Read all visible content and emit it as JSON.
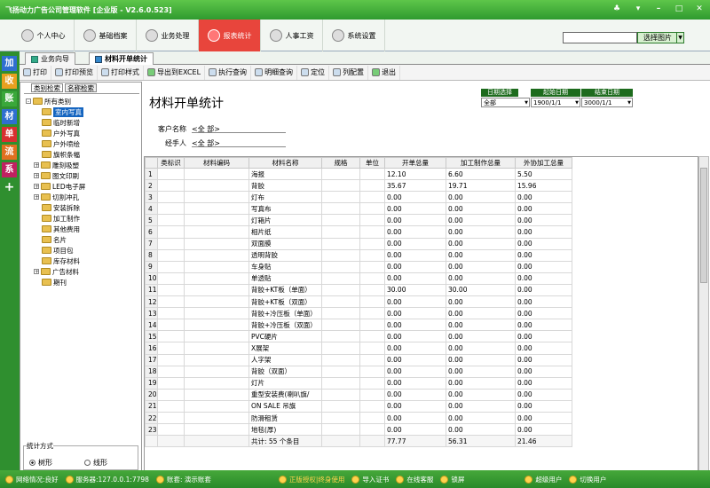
{
  "window": {
    "title": "飞扬动力广告公司管理软件 [企业版 - V2.6.0.523]"
  },
  "menu": [
    {
      "label": "个人中心"
    },
    {
      "label": "基础档案"
    },
    {
      "label": "业务处理"
    },
    {
      "label": "报表统计",
      "active": true
    },
    {
      "label": "人事工资"
    },
    {
      "label": "系统设置"
    }
  ],
  "search": {
    "button": "选择图片"
  },
  "left_tabs": [
    "加",
    "收",
    "账",
    "材",
    "单",
    "流",
    "系",
    "+"
  ],
  "doc_tabs": [
    {
      "label": "业务向导"
    },
    {
      "label": "材料开单统计",
      "active": true
    }
  ],
  "toolbar": [
    "打印",
    "打印预览",
    "打印样式",
    "导出到EXCEL",
    "执行查询",
    "明细查询",
    "定位",
    "列配置",
    "退出"
  ],
  "tree_tabs": [
    "类别检索",
    "名称检索"
  ],
  "tree": [
    {
      "label": "所有类别",
      "level": 0,
      "expander": "-"
    },
    {
      "label": "室内写真",
      "level": 1,
      "selected": true
    },
    {
      "label": "临时新增",
      "level": 1
    },
    {
      "label": "户外写真",
      "level": 1
    },
    {
      "label": "户外喷绘",
      "level": 1
    },
    {
      "label": "旗帜条幅",
      "level": 1
    },
    {
      "label": "雕刻吸塑",
      "level": 1,
      "expander": "+"
    },
    {
      "label": "图文印刷",
      "level": 1,
      "expander": "+"
    },
    {
      "label": "LED电子屏",
      "level": 1,
      "expander": "+"
    },
    {
      "label": "切割冲孔",
      "level": 1,
      "expander": "+"
    },
    {
      "label": "安装拆除",
      "level": 1
    },
    {
      "label": "加工制作",
      "level": 1
    },
    {
      "label": "其他费用",
      "level": 1
    },
    {
      "label": "名片",
      "level": 1
    },
    {
      "label": "项目包",
      "level": 1
    },
    {
      "label": "库存材料",
      "level": 1
    },
    {
      "label": "广告材料",
      "level": 1,
      "expander": "+"
    },
    {
      "label": "期刊",
      "level": 1
    }
  ],
  "stat_mode": {
    "caption": "统计方式",
    "options": [
      {
        "label": "树形",
        "checked": true
      },
      {
        "label": "线形",
        "checked": false
      }
    ]
  },
  "report": {
    "title": "材料开单统计",
    "date_filter": {
      "label": "日期选择",
      "value": "全部"
    },
    "start_date": {
      "label": "起始日期",
      "value": "1900/1/1"
    },
    "end_date": {
      "label": "结束日期",
      "value": "3000/1/1"
    },
    "customer": {
      "label": "客户名称",
      "value": "<全 部>"
    },
    "handler": {
      "label": "经手人",
      "value": "<全 部>"
    }
  },
  "grid": {
    "columns": [
      "",
      "类标识",
      "材料编码",
      "材料名称",
      "规格",
      "单位",
      "开单总量",
      "加工制作总量",
      "外协加工总量"
    ],
    "rows": [
      [
        "1",
        "",
        "",
        "海报",
        "",
        "",
        "12.10",
        "6.60",
        "5.50"
      ],
      [
        "2",
        "",
        "",
        "背胶",
        "",
        "",
        "35.67",
        "19.71",
        "15.96"
      ],
      [
        "3",
        "",
        "",
        "灯布",
        "",
        "",
        "0.00",
        "0.00",
        "0.00"
      ],
      [
        "4",
        "",
        "",
        "写真布",
        "",
        "",
        "0.00",
        "0.00",
        "0.00"
      ],
      [
        "5",
        "",
        "",
        "灯箱片",
        "",
        "",
        "0.00",
        "0.00",
        "0.00"
      ],
      [
        "6",
        "",
        "",
        "相片纸",
        "",
        "",
        "0.00",
        "0.00",
        "0.00"
      ],
      [
        "7",
        "",
        "",
        "双面膜",
        "",
        "",
        "0.00",
        "0.00",
        "0.00"
      ],
      [
        "8",
        "",
        "",
        "透明背胶",
        "",
        "",
        "0.00",
        "0.00",
        "0.00"
      ],
      [
        "9",
        "",
        "",
        "车身贴",
        "",
        "",
        "0.00",
        "0.00",
        "0.00"
      ],
      [
        "10",
        "",
        "",
        "单透贴",
        "",
        "",
        "0.00",
        "0.00",
        "0.00"
      ],
      [
        "11",
        "",
        "",
        "背胶+KT板（单面）",
        "",
        "",
        "30.00",
        "30.00",
        "0.00"
      ],
      [
        "12",
        "",
        "",
        "背胶+KT板（双面）",
        "",
        "",
        "0.00",
        "0.00",
        "0.00"
      ],
      [
        "13",
        "",
        "",
        "背胶+冷压板（单面）",
        "",
        "",
        "0.00",
        "0.00",
        "0.00"
      ],
      [
        "14",
        "",
        "",
        "背胶+冷压板（双面）",
        "",
        "",
        "0.00",
        "0.00",
        "0.00"
      ],
      [
        "15",
        "",
        "",
        "PVC硬片",
        "",
        "",
        "0.00",
        "0.00",
        "0.00"
      ],
      [
        "16",
        "",
        "",
        "X展架",
        "",
        "",
        "0.00",
        "0.00",
        "0.00"
      ],
      [
        "17",
        "",
        "",
        "人字架",
        "",
        "",
        "0.00",
        "0.00",
        "0.00"
      ],
      [
        "18",
        "",
        "",
        "背胶（双面）",
        "",
        "",
        "0.00",
        "0.00",
        "0.00"
      ],
      [
        "19",
        "",
        "",
        "灯片",
        "",
        "",
        "0.00",
        "0.00",
        "0.00"
      ],
      [
        "20",
        "",
        "",
        "重型安装费(喇叭旗/",
        "",
        "",
        "0.00",
        "0.00",
        "0.00"
      ],
      [
        "21",
        "",
        "",
        "ON SALE 吊旗",
        "",
        "",
        "0.00",
        "0.00",
        "0.00"
      ],
      [
        "22",
        "",
        "",
        "防滑租赁",
        "",
        "",
        "0.00",
        "0.00",
        "0.00"
      ],
      [
        "23",
        "",
        "",
        "地毯(厚)",
        "",
        "",
        "0.00",
        "0.00",
        "0.00"
      ]
    ],
    "footer": [
      "",
      "",
      "",
      "共计: 55 个条目",
      "",
      "",
      "77.77",
      "56.31",
      "21.46"
    ]
  },
  "status": [
    {
      "label": "网络情况:良好"
    },
    {
      "label": "服务器:127.0.0.1:7798"
    },
    {
      "label": "账套: 演示账套"
    },
    {
      "label": "正版授权|终身使用",
      "dim": true
    },
    {
      "label": "导入证书"
    },
    {
      "label": "在线客服"
    },
    {
      "label": "锁屏"
    },
    {
      "label": "超级用户"
    },
    {
      "label": "切换用户"
    }
  ]
}
